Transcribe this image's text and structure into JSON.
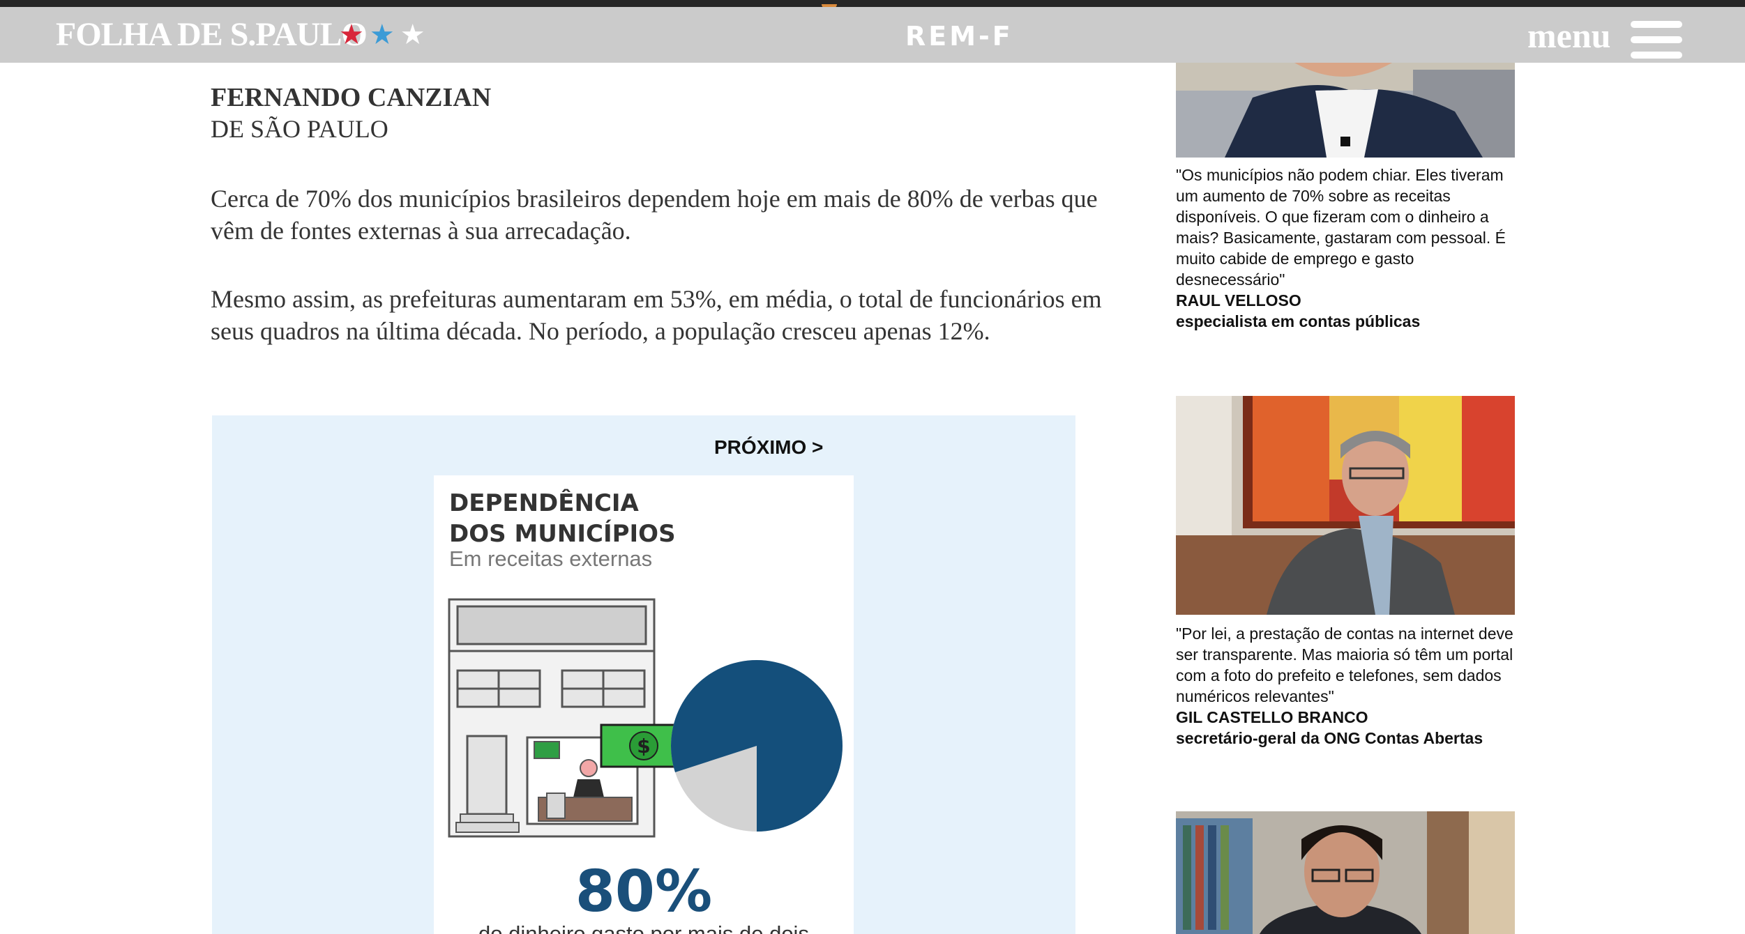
{
  "header": {
    "logo": "FOLHA DE S.PAULO",
    "stars": [
      "★",
      "★",
      "★"
    ],
    "section": "REM-F",
    "menu_label": "menu"
  },
  "article": {
    "author": "FERNANDO CANZIAN",
    "location": "DE SÃO PAULO",
    "paragraphs": [
      "Cerca de 70% dos municípios brasileiros dependem hoje em mais de 80% de verbas que vêm de fontes externas à sua arrecadação.",
      "Mesmo assim, as prefeituras aumentaram em 53%, em média, o total de funcionários em seus quadros na última década. No período, a população cresceu apenas 12%."
    ]
  },
  "graphic": {
    "next_label": "PRÓXIMO >",
    "title_line1": "DEPENDÊNCIA",
    "title_line2": "DOS MUNICÍPIOS",
    "subtitle": "Em receitas externas",
    "percent": "80%",
    "percent_desc": "do dinheiro gasto por mais de dois",
    "pie_share": 0.8
  },
  "quotes": [
    {
      "quote": "\"Os municípios não podem chiar. Eles tiveram um aumento de 70% sobre as receitas disponíveis. O que fizeram com o dinheiro a mais? Basicamente, gastaram com pessoal. É muito cabide de emprego e gasto desnecessário\"",
      "name": "RAUL VELLOSO",
      "role": "especialista em contas públicas"
    },
    {
      "quote": "\"Por lei, a prestação de contas na internet deve ser transparente. Mas maioria só têm um portal com a foto do prefeito e telefones, sem dados numéricos relevantes\"",
      "name": "GIL CASTELLO BRANCO",
      "role": "secretário-geral da ONG Contas Abertas"
    }
  ],
  "colors": {
    "header_bg": "#cbcbcb",
    "graphic_bg": "#e6f2fb",
    "pie_dark": "#144f7b",
    "pie_light": "#d3d3d3",
    "percent": "#1a4f7a",
    "bill_green": "#3fbf4a"
  }
}
